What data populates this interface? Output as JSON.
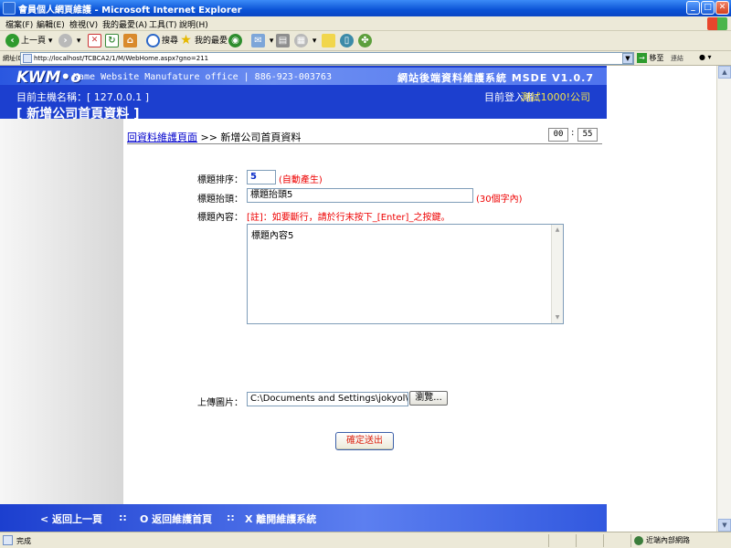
{
  "window": {
    "title": "會員個人網頁維護 - Microsoft Internet Explorer",
    "minimize_glyph": "_",
    "maximize_glyph": "□",
    "close_glyph": "✕"
  },
  "menu": [
    "檔案(F)",
    "編輯(E)",
    "檢視(V)",
    "我的最愛(A)",
    "工具(T)",
    "說明(H)"
  ],
  "toolbar": {
    "back_label": "上一頁",
    "search_label": "搜尋",
    "favorites_label": "我的最愛"
  },
  "address": {
    "label": "網址(D)",
    "url": "http://localhost/TCBCA2/1/M/WebHome.aspx?gno=211",
    "go_label": "移至",
    "links_label": "連結"
  },
  "site": {
    "logo": "KWM•o",
    "tagline": "Kame Website Manufature office | 886-923-003763",
    "system_name": "網站後端資料維護系統 MSDE V1.0.7",
    "host_label": "目前主機名稱：[ 127.0.0.1 ]",
    "login_label": "目前登入者：",
    "login_user": "測試1000!公司",
    "page_heading": "[ 新增公司首頁資料 ]"
  },
  "breadcrumb": {
    "link": "回資料維護頁面",
    "current": ">> 新增公司首頁資料"
  },
  "clock": {
    "minutes": "00",
    "seconds": "55",
    "separator": ":"
  },
  "form": {
    "order_label": "標題排序：",
    "order_value": "5",
    "order_note": "(自動產生)",
    "header_label": "標題抬頭：",
    "header_value": "標題抬頭5",
    "header_note": "(30個字內)",
    "content_label": "標題內容：",
    "content_note": "[註]：如要斷行，請於行末按下_[Enter]_之按鍵。",
    "content_value": "標題內容5",
    "upload_label": "上傳圖片：",
    "upload_value": "C:\\Documents and Settings\\jokyol\\M",
    "browse_label": "瀏覽...",
    "submit_label": "確定送出"
  },
  "footer": {
    "back": "< 返回上一頁",
    "home": "O 返回維護首頁",
    "exit": "X 離開維護系統",
    "separator": "::"
  },
  "status": {
    "text": "完成",
    "zone": "近端內部網路"
  }
}
